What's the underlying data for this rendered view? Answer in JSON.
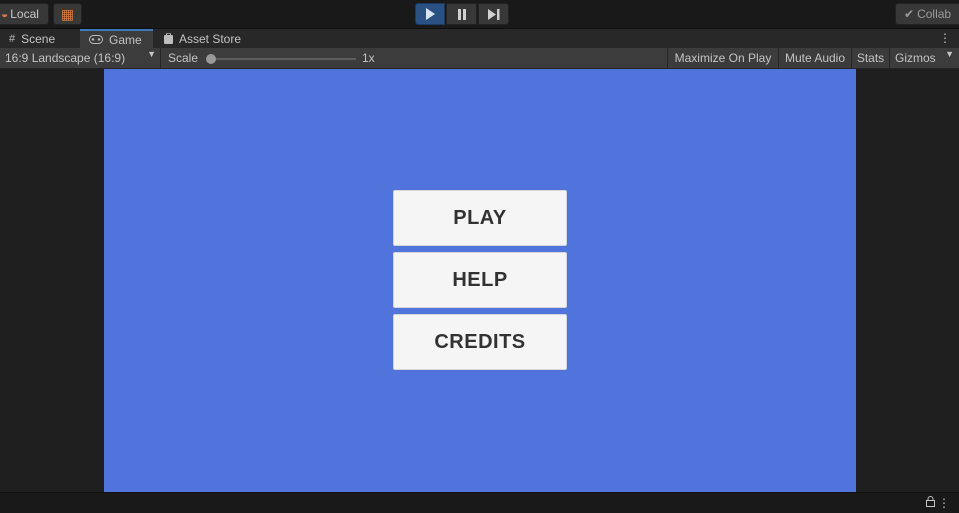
{
  "toolbar": {
    "local_label": "Local",
    "collab_label": "Collab"
  },
  "tabs": [
    {
      "label": "Scene",
      "icon": "grid-icon"
    },
    {
      "label": "Game",
      "icon": "gamepad-icon",
      "active": true
    },
    {
      "label": "Asset Store",
      "icon": "shopping-bag-icon"
    }
  ],
  "game_bar": {
    "aspect": "16:9 Landscape (16:9)",
    "scale_label": "Scale",
    "scale_value": "1x",
    "maximize_label": "Maximize On Play",
    "mute_label": "Mute Audio",
    "stats_label": "Stats",
    "gizmos_label": "Gizmos"
  },
  "game_view": {
    "background": "#5073dc",
    "menu": [
      {
        "label": "PLAY"
      },
      {
        "label": "HELP"
      },
      {
        "label": "CREDITS"
      }
    ]
  },
  "colors": {
    "editor_bg": "#191919",
    "panel_bg": "#3c3c3c",
    "play_active": "#2a5181",
    "tab_accent": "#3a79bb"
  }
}
